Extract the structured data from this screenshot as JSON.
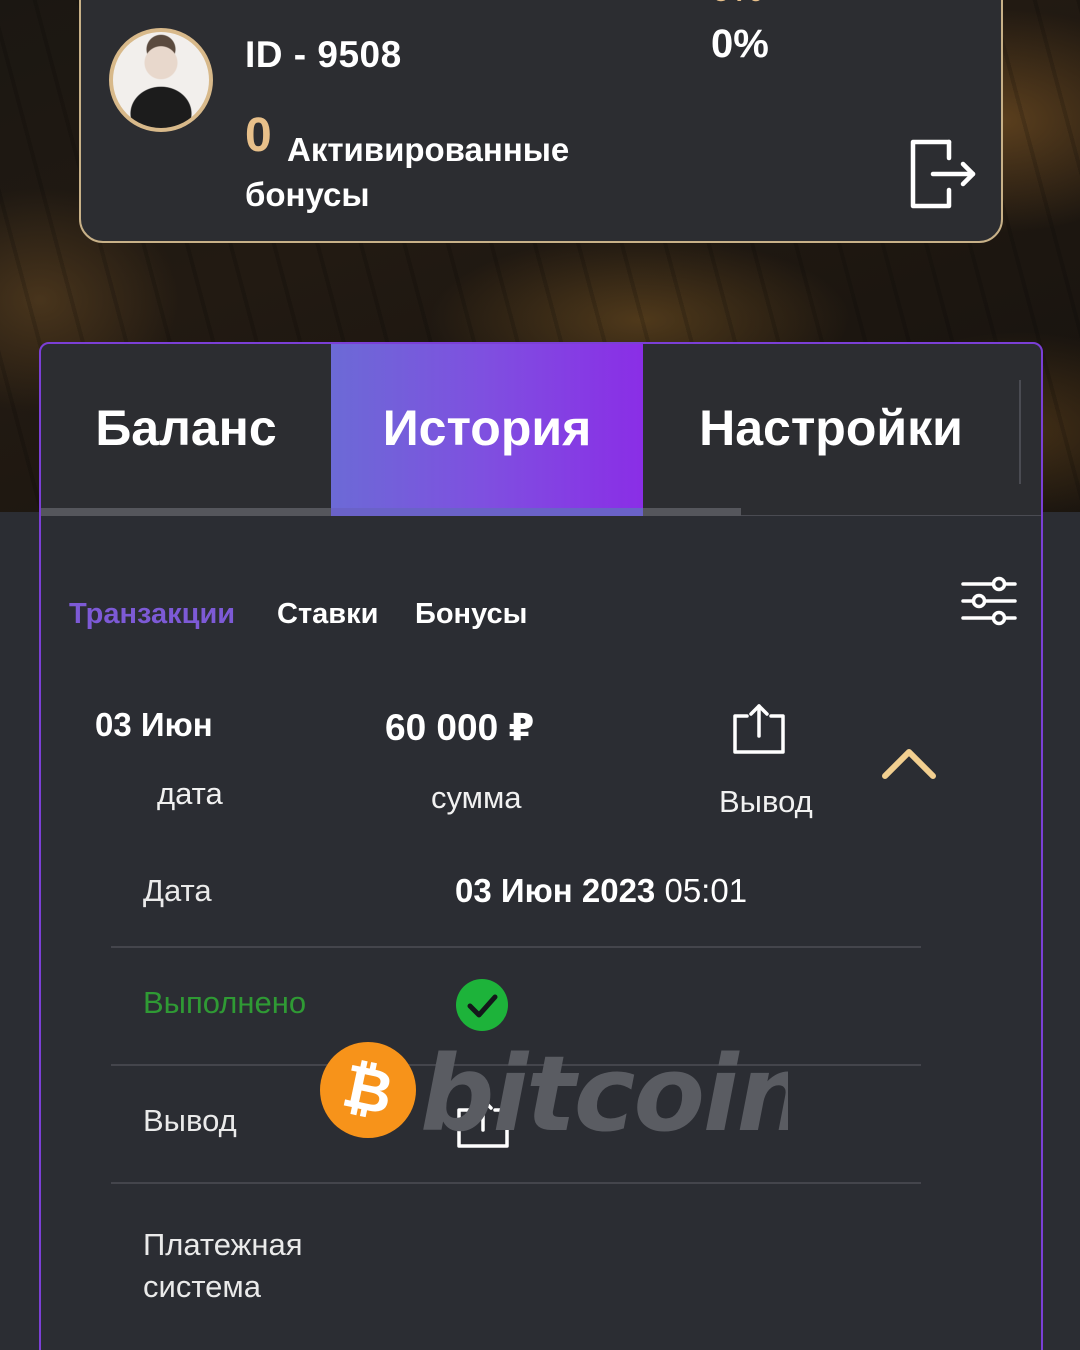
{
  "profile": {
    "user_id": "ID - 9508",
    "bonus_count": "0",
    "bonus_label_line1": "Активированные",
    "bonus_label_line2": "бонусы",
    "percent": "0%"
  },
  "tabs": [
    {
      "label": "Баланс",
      "active": false
    },
    {
      "label": "История",
      "active": true
    },
    {
      "label": "Настройки",
      "active": false
    }
  ],
  "subtabs": [
    {
      "label": "Транзакции",
      "active": true
    },
    {
      "label": "Ставки",
      "active": false
    },
    {
      "label": "Бонусы",
      "active": false
    }
  ],
  "transaction": {
    "date": "03 Июн",
    "date_caption": "дата",
    "amount": "60 000 ₽",
    "amount_caption": "сумма",
    "type": "Вывод"
  },
  "details": {
    "date_label": "Дата",
    "date_value": "03 Июн 2023",
    "time_value": "05:01",
    "status_label": "Выполнено",
    "type_label": "Вывод",
    "payment_label_line1": "Платежная",
    "payment_label_line2": "система",
    "payment_system": "bitcoin"
  },
  "colors": {
    "accent_purple": "#7d5ad6",
    "gold": "#e8c08a",
    "success_green": "#1db33a",
    "status_text_green": "#2f9a34",
    "bitcoin_orange": "#f7931a"
  },
  "icons": [
    "avatar",
    "logout-icon",
    "filter-icon",
    "upload-icon",
    "chevron-up-icon",
    "check-icon",
    "bitcoin-icon"
  ]
}
